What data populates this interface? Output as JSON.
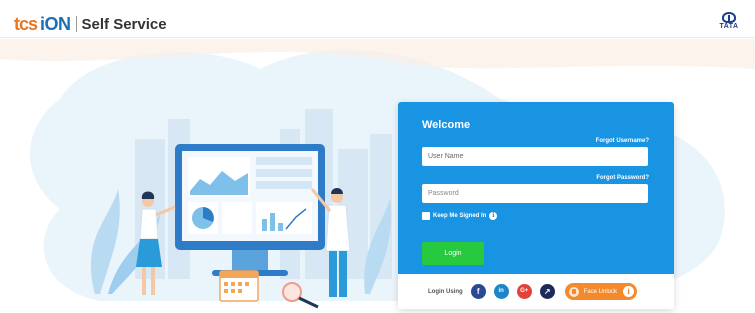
{
  "header": {
    "logo_tcs": "tcs",
    "logo_ion": "iON",
    "logo_service": "Self Service",
    "brand_right": "TATA"
  },
  "login": {
    "title": "Welcome",
    "forgot_username": "Forgot Username?",
    "username_placeholder": "User Name",
    "forgot_password": "Forgot Password?",
    "password_placeholder": "Password",
    "keep_signed_in": "Keep Me Signed In",
    "login_button": "Login",
    "login_using": "Login Using",
    "face_unlock": "Face Unlock",
    "social": {
      "facebook": "f",
      "linkedin": "in",
      "google": "G+",
      "other": "↗"
    }
  },
  "colors": {
    "card": "#1894e3",
    "login_button": "#27c93f",
    "face_unlock": "#f58a2c",
    "tcs_orange": "#e87722",
    "ion_blue": "#1a6fb5"
  }
}
